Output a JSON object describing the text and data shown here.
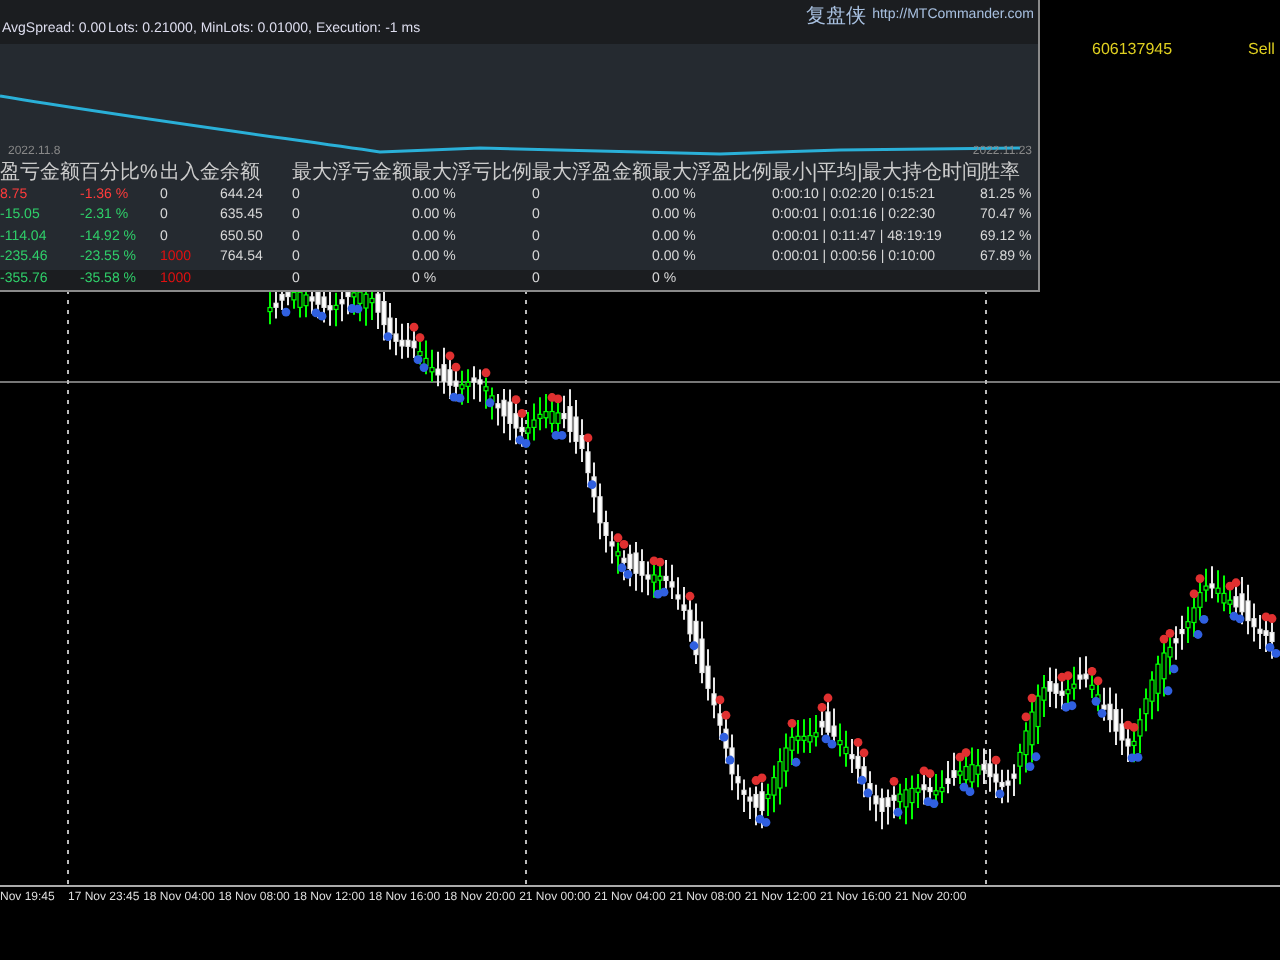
{
  "report_panel": {
    "status_text": "AvgSpread: 0.00",
    "status_detail": "Lots: 0.21000, MinLots: 0.01000, Execution: -1 ms",
    "brand": "复盘侠",
    "url": "http://MTCommander.com",
    "curve_start_date": "2022.11.8",
    "curve_end_date": "2022.11.23",
    "columns": [
      "盈亏金额",
      "百分比%",
      "出入金",
      "余额",
      "最大浮亏金额",
      "最大浮亏比例",
      "最大浮盈金额",
      "最大浮盈比例",
      "最小|平均|最大持仓时间",
      "胜率"
    ],
    "rows": [
      {
        "kind": "trade",
        "cells": [
          {
            "text": "8.75",
            "color": "#ff3b3b"
          },
          {
            "text": "-1.36 %",
            "color": "#ff3b3b"
          },
          {
            "text": "0"
          },
          {
            "text": "644.24"
          },
          {
            "text": "0"
          },
          {
            "text": "0.00 %"
          },
          {
            "text": "0"
          },
          {
            "text": "0.00 %"
          },
          {
            "text": "0:00:10 | 0:02:20 | 0:15:21"
          },
          {
            "text": "81.25 %"
          }
        ]
      },
      {
        "kind": "trade",
        "cells": [
          {
            "text": "-15.05",
            "color": "#2fd06a"
          },
          {
            "text": "-2.31 %",
            "color": "#2fd06a"
          },
          {
            "text": "0"
          },
          {
            "text": "635.45"
          },
          {
            "text": "0"
          },
          {
            "text": "0.00 %"
          },
          {
            "text": "0"
          },
          {
            "text": "0.00 %"
          },
          {
            "text": "0:00:01 | 0:01:16 | 0:22:30"
          },
          {
            "text": "70.47 %"
          }
        ]
      },
      {
        "kind": "trade",
        "cells": [
          {
            "text": "-114.04",
            "color": "#2fd06a"
          },
          {
            "text": "-14.92 %",
            "color": "#2fd06a"
          },
          {
            "text": "0"
          },
          {
            "text": "650.50"
          },
          {
            "text": "0"
          },
          {
            "text": "0.00 %"
          },
          {
            "text": "0"
          },
          {
            "text": "0.00 %"
          },
          {
            "text": "0:00:01 | 0:11:47 | 48:19:19"
          },
          {
            "text": "69.12 %"
          }
        ]
      },
      {
        "kind": "trade",
        "cells": [
          {
            "text": "-235.46",
            "color": "#2fd06a"
          },
          {
            "text": "-23.55 %",
            "color": "#2fd06a"
          },
          {
            "text": "1000",
            "color": "#e01010"
          },
          {
            "text": "764.54"
          },
          {
            "text": "0"
          },
          {
            "text": "0.00 %"
          },
          {
            "text": "0"
          },
          {
            "text": "0.00 %"
          },
          {
            "text": "0:00:01 | 0:00:56 | 0:10:00"
          },
          {
            "text": "67.89 %"
          }
        ]
      },
      {
        "kind": "total",
        "cells": [
          {
            "text": "-355.76",
            "color": "#2fd06a"
          },
          {
            "text": "-35.58 %",
            "color": "#2fd06a"
          },
          {
            "text": "1000",
            "color": "#e01010"
          },
          {
            "text": ""
          },
          {
            "text": "0"
          },
          {
            "text": "0 %"
          },
          {
            "text": "0"
          },
          {
            "text": "0 %"
          },
          {
            "text": ""
          },
          {
            "text": ""
          }
        ]
      }
    ]
  },
  "order_info": {
    "ticket": "606137945",
    "type": "Sell"
  },
  "time_axis": [
    "Nov 19:45",
    "17 Nov 23:45",
    "18 Nov 04:00",
    "18 Nov 08:00",
    "18 Nov 12:00",
    "18 Nov 16:00",
    "18 Nov 20:00",
    "21 Nov 00:00",
    "21 Nov 04:00",
    "21 Nov 08:00",
    "21 Nov 12:00",
    "21 Nov 16:00",
    "21 Nov 20:00"
  ]
}
